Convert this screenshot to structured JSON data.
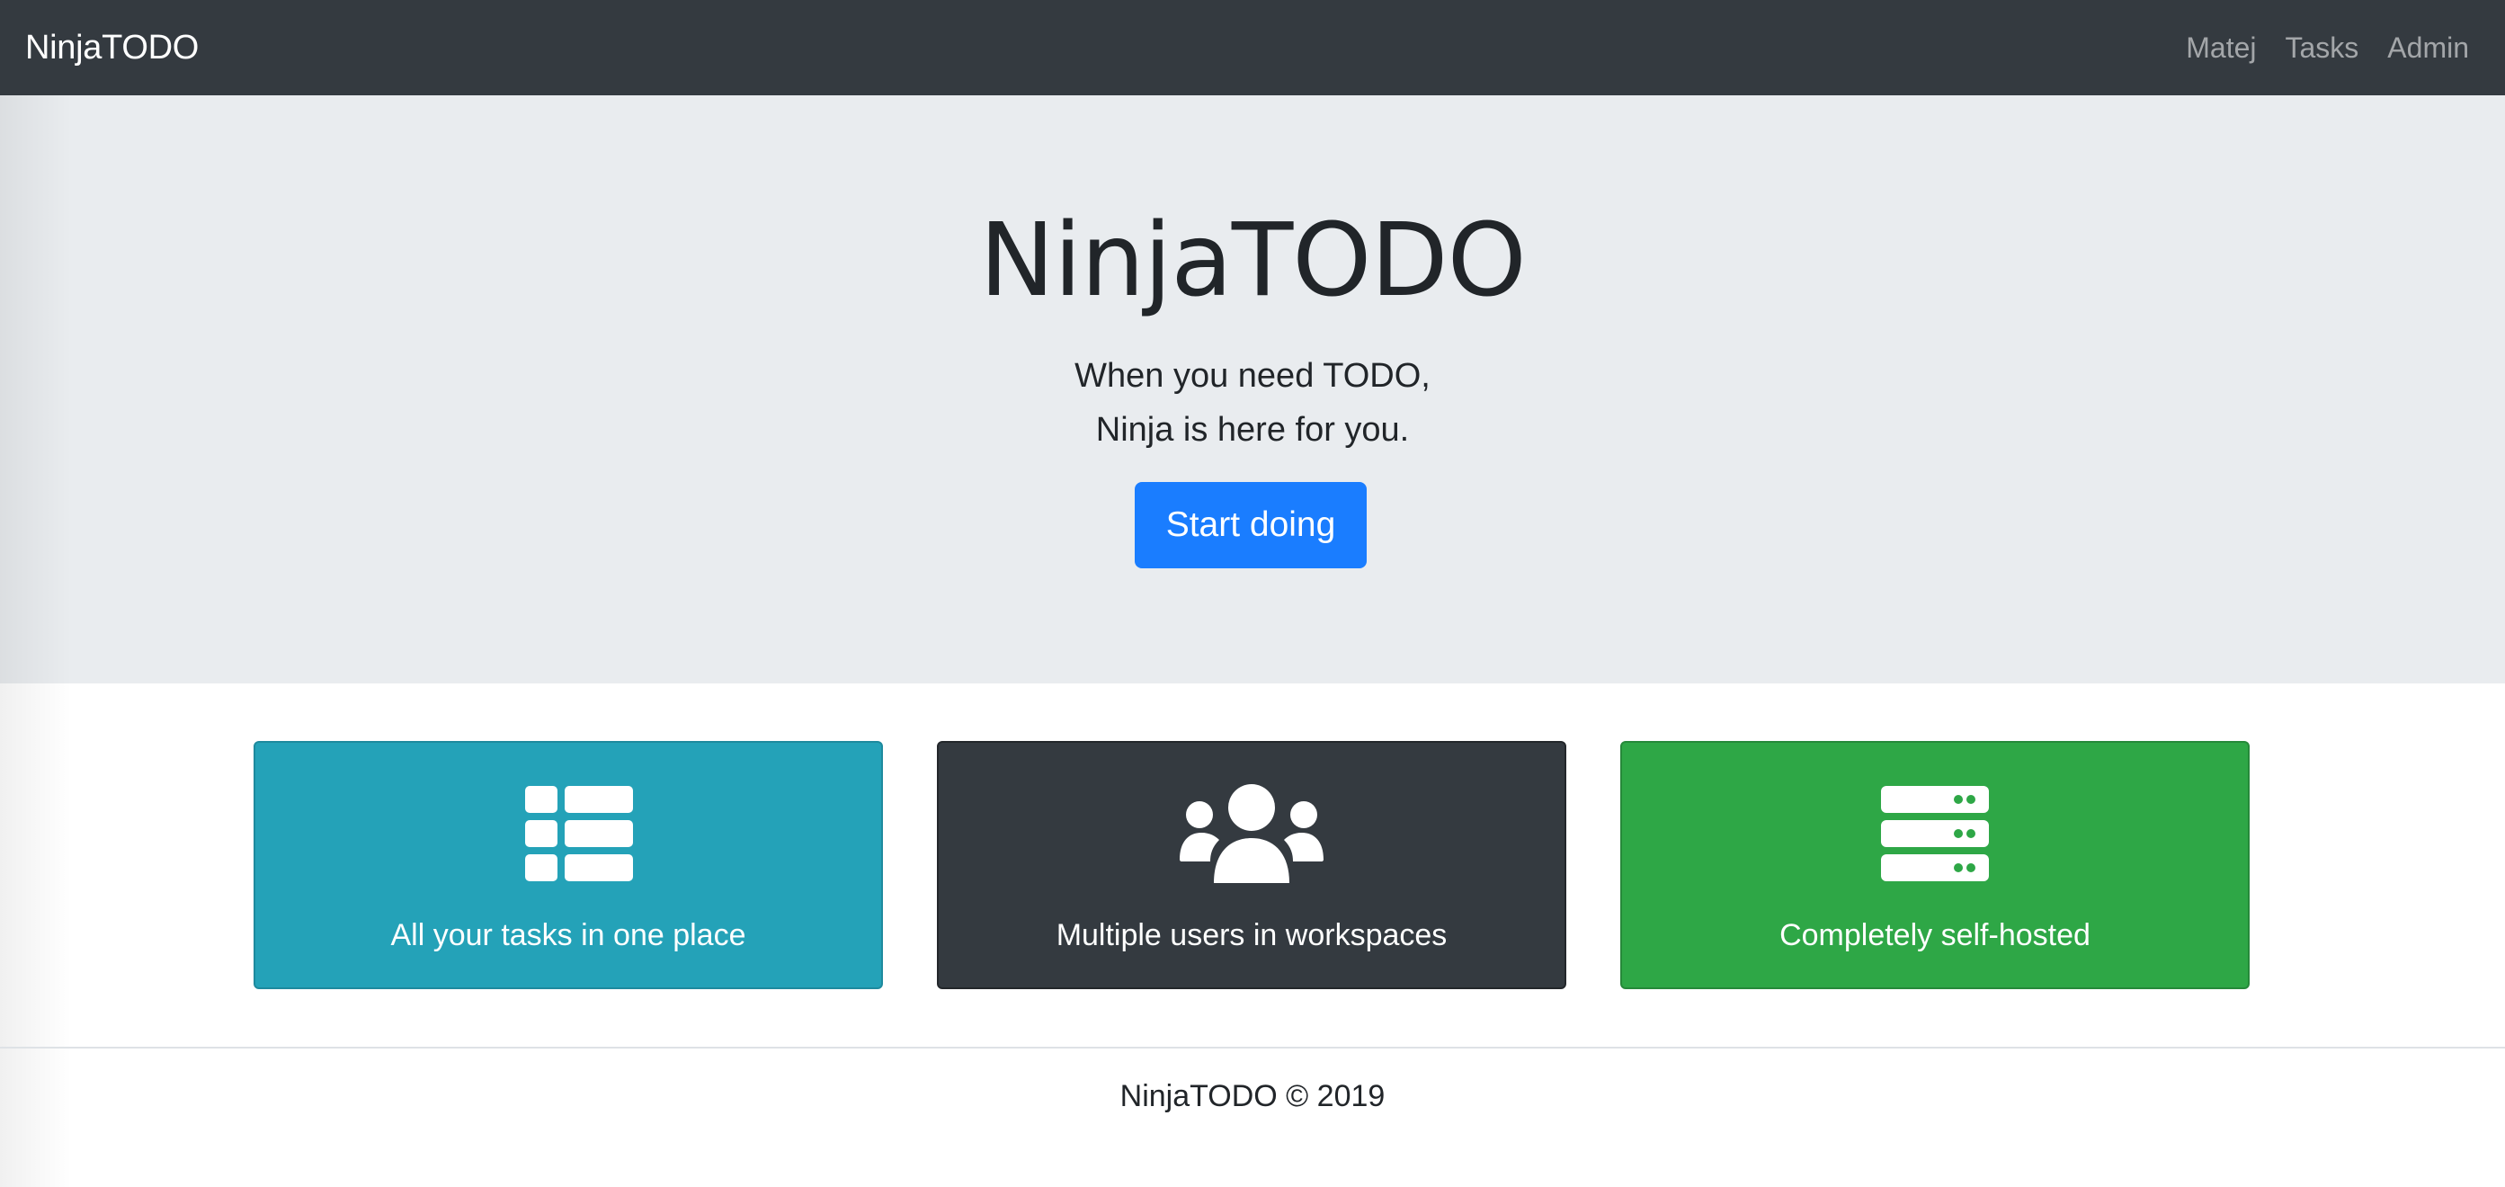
{
  "navbar": {
    "brand": "NinjaTODO",
    "links": [
      {
        "label": "Matej"
      },
      {
        "label": "Tasks"
      },
      {
        "label": "Admin"
      }
    ]
  },
  "hero": {
    "title": "NinjaTODO",
    "lead_line_1": "When you need TODO,",
    "lead_line_2": "Ninja is here for you.",
    "cta_label": "Start doing"
  },
  "features": [
    {
      "icon": "list-icon",
      "text": "All your tasks in one place",
      "color": "#24a2b8"
    },
    {
      "icon": "users-icon",
      "text": "Multiple users in workspaces",
      "color": "#343a40"
    },
    {
      "icon": "server-icon",
      "text": "Completely self-hosted",
      "color": "#2ea746"
    }
  ],
  "footer": {
    "text": "NinjaTODO © 2019"
  }
}
